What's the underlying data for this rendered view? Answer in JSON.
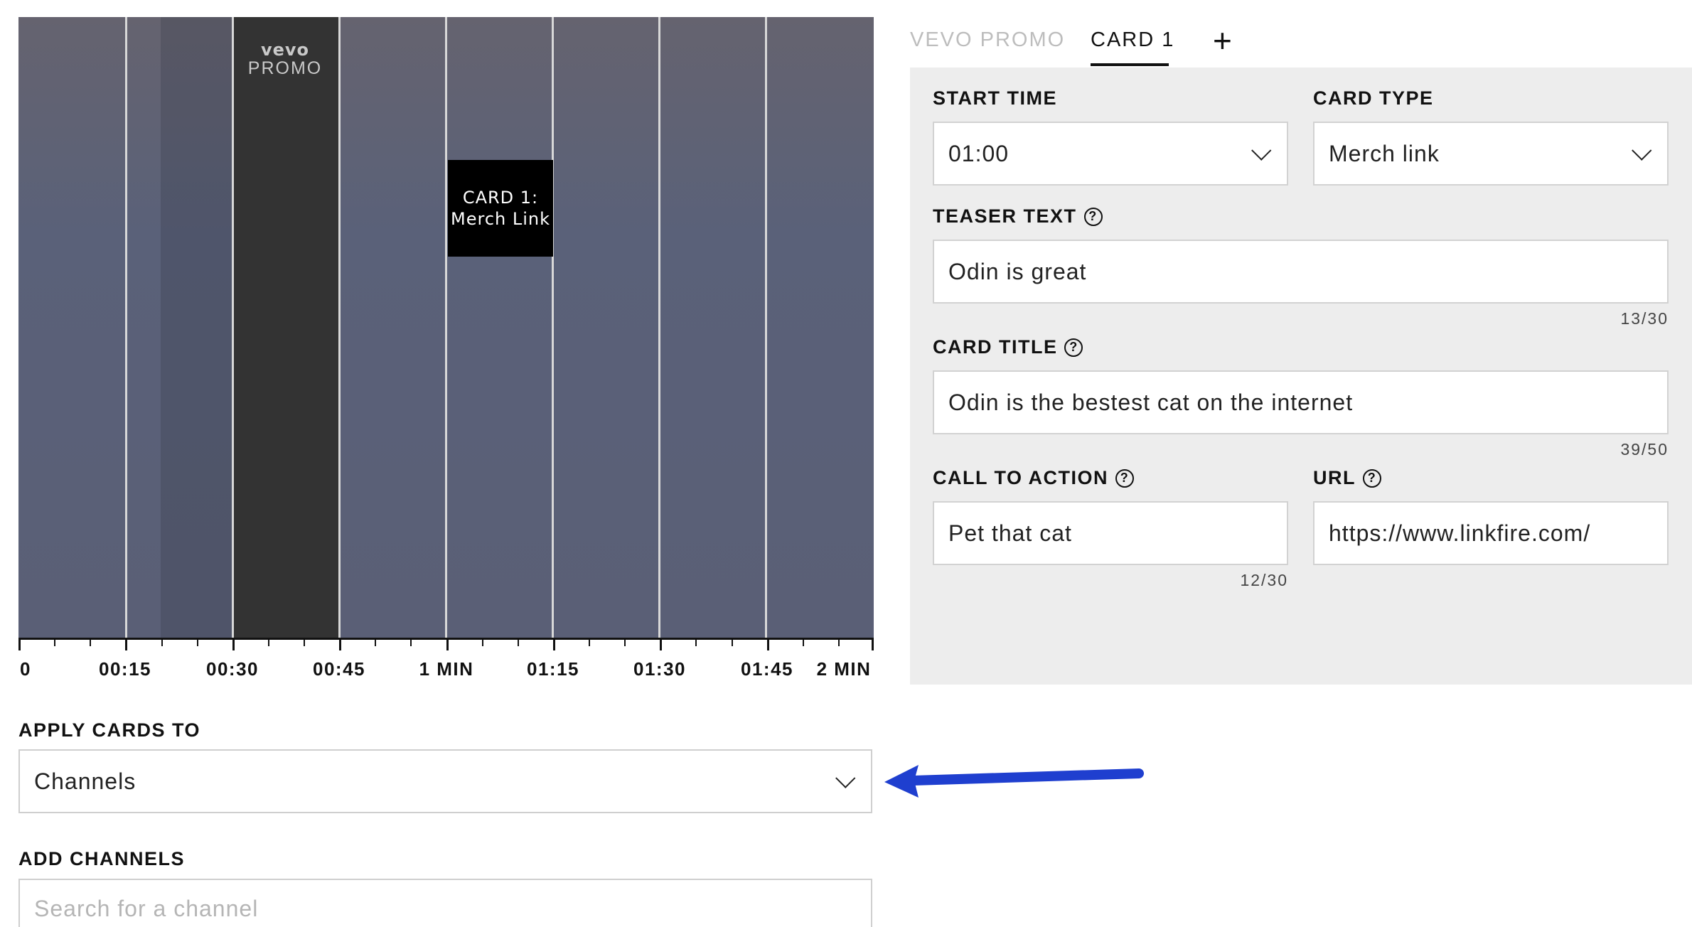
{
  "timeline": {
    "promo_logo": "vevo",
    "promo_text": "PROMO",
    "card_marker": {
      "line1": "CARD 1:",
      "line2": "Merch Link"
    },
    "tick_labels": [
      "0",
      "00:15",
      "00:30",
      "00:45",
      "1 MIN",
      "01:15",
      "01:30",
      "01:45",
      "2 MIN"
    ]
  },
  "apply_cards": {
    "label": "APPLY CARDS TO",
    "selected": "Channels"
  },
  "add_channels": {
    "label": "ADD CHANNELS",
    "placeholder": "Search for a channel"
  },
  "tabs": [
    {
      "label": "VEVO PROMO",
      "active": false
    },
    {
      "label": "CARD 1",
      "active": true
    }
  ],
  "tab_add_label": "+",
  "card_form": {
    "start_time": {
      "label": "START TIME",
      "value": "01:00"
    },
    "card_type": {
      "label": "CARD TYPE",
      "value": "Merch link"
    },
    "teaser_text": {
      "label": "TEASER TEXT",
      "value": "Odin is great",
      "counter": "13/30"
    },
    "card_title": {
      "label": "CARD TITLE",
      "value": "Odin is the bestest cat on the internet",
      "counter": "39/50"
    },
    "call_to_action": {
      "label": "CALL TO ACTION",
      "value": "Pet that cat",
      "counter": "12/30"
    },
    "url": {
      "label": "URL",
      "value": "https://www.linkfire.com/"
    }
  },
  "help_glyph": "?",
  "colors": {
    "promo_segment": "#333333",
    "card_marker": "#000000",
    "panel_bg": "#ededed",
    "annotation_arrow": "#1f3fcf"
  }
}
